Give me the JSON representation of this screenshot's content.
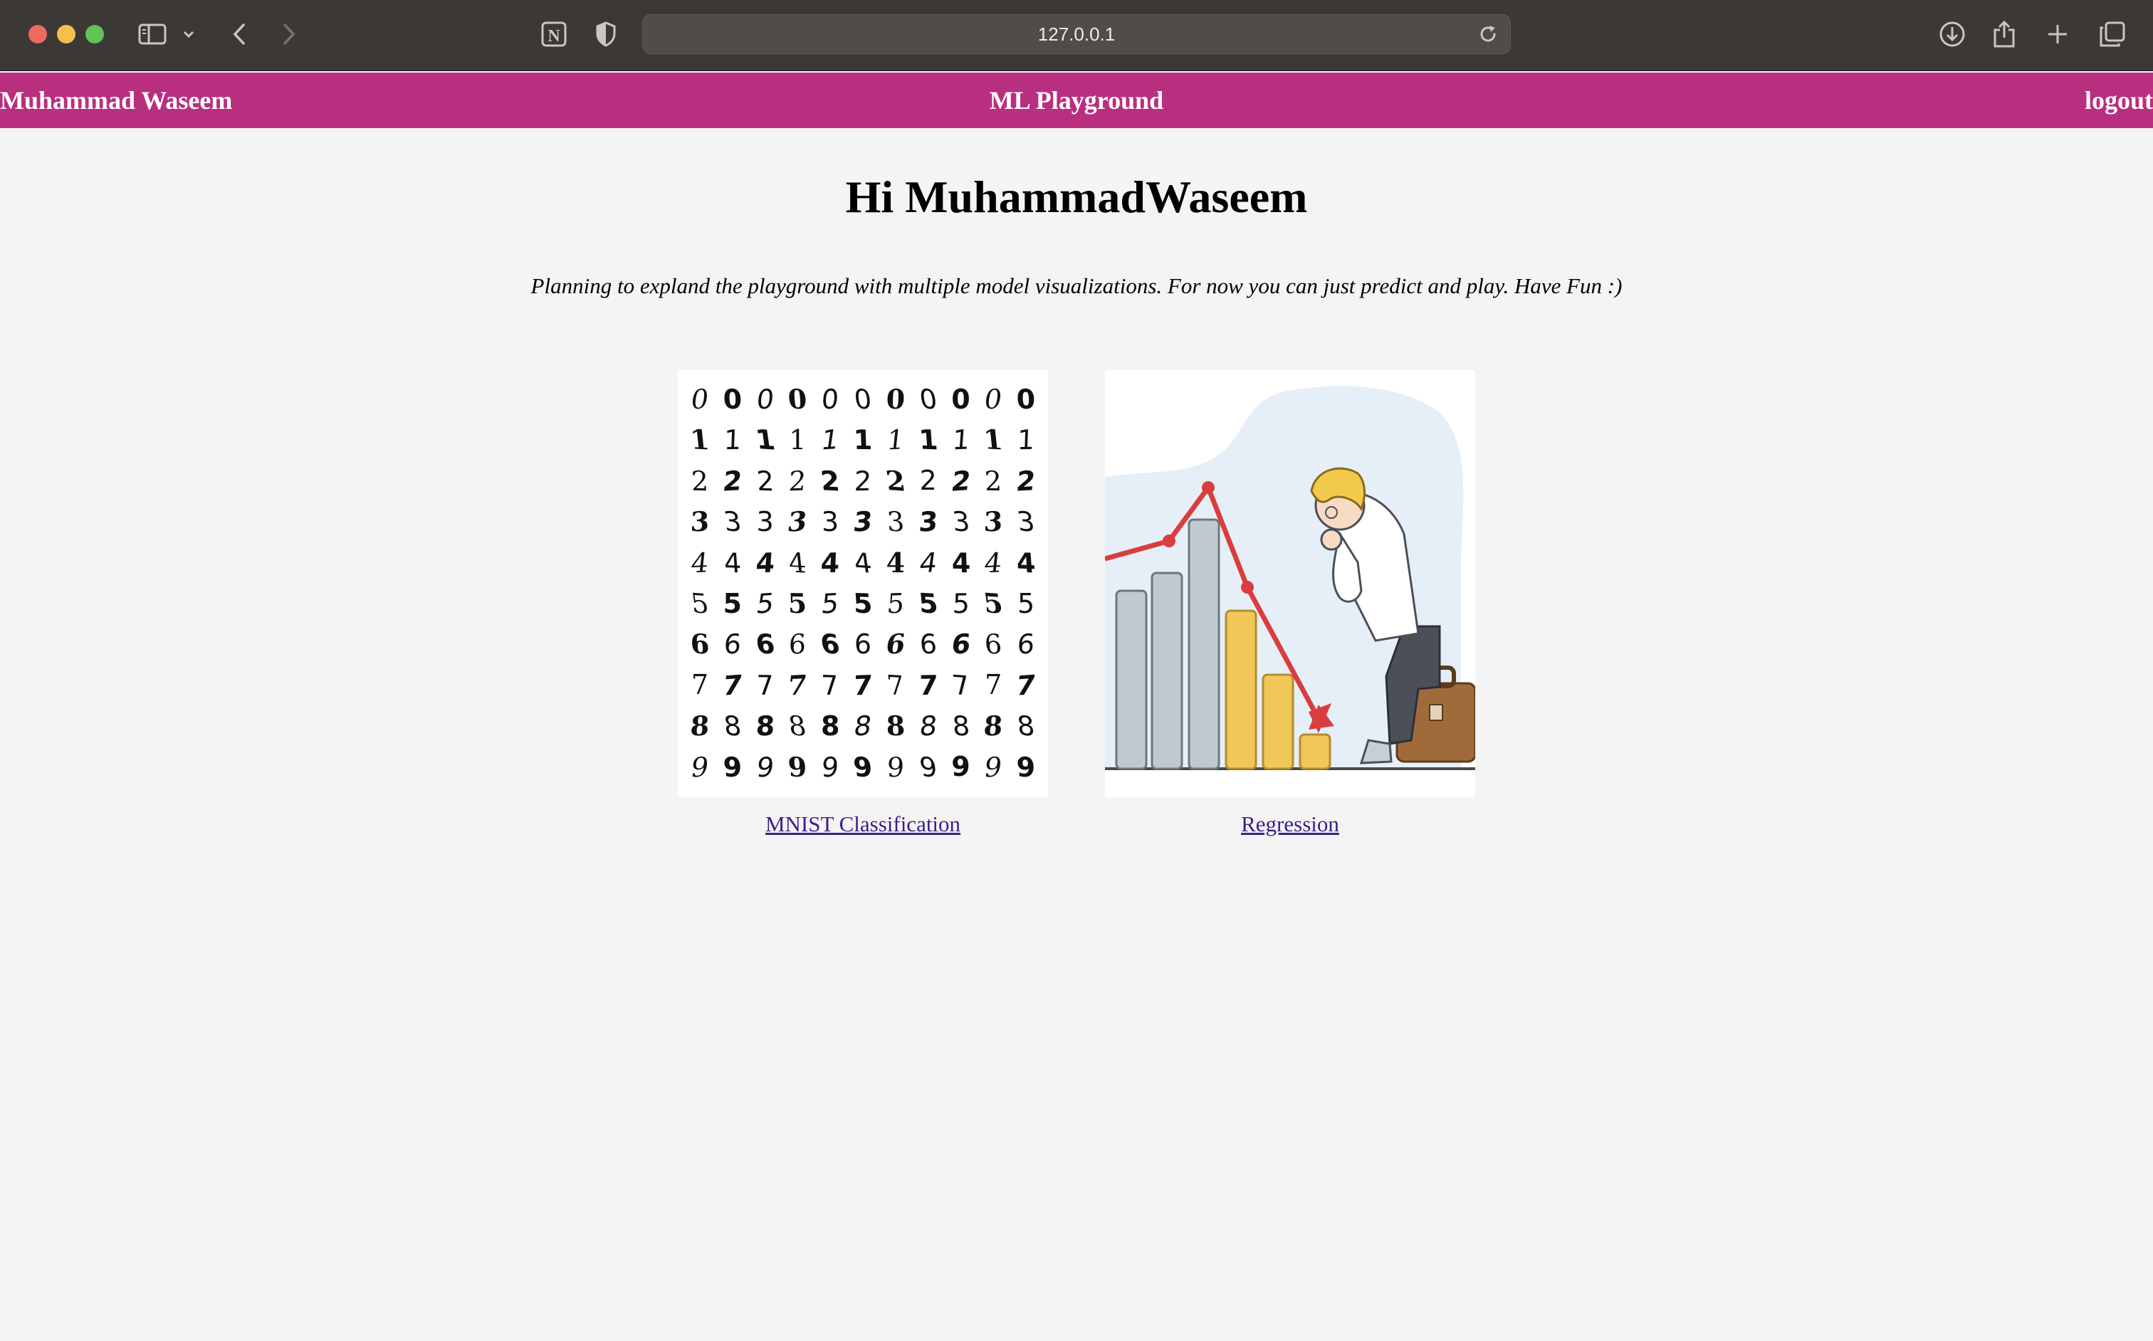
{
  "browser": {
    "url": "127.0.0.1",
    "icons": [
      "sidebar-icon",
      "chevron-down-icon",
      "back-icon",
      "forward-icon",
      "notion-icon",
      "shield-icon",
      "reload-icon",
      "download-icon",
      "share-icon",
      "new-tab-icon",
      "tabs-overview-icon"
    ]
  },
  "navbar": {
    "user_name": "Muhammad Waseem",
    "app_title": "ML Playground",
    "logout_label": "logout",
    "background_color": "#b82f80"
  },
  "main": {
    "greeting": "Hi MuhammadWaseem",
    "subtitle": "Planning to expland the playground with multiple model visualizations. For now you can just predict and play. Have Fun :)",
    "cards": [
      {
        "label": "MNIST Classification",
        "image": "mnist-digits-grid",
        "digit_rows": [
          "0",
          "1",
          "2",
          "3",
          "4",
          "5",
          "6",
          "7",
          "8",
          "9"
        ]
      },
      {
        "label": "Regression",
        "image": "declining-bar-chart-illustration"
      }
    ]
  }
}
